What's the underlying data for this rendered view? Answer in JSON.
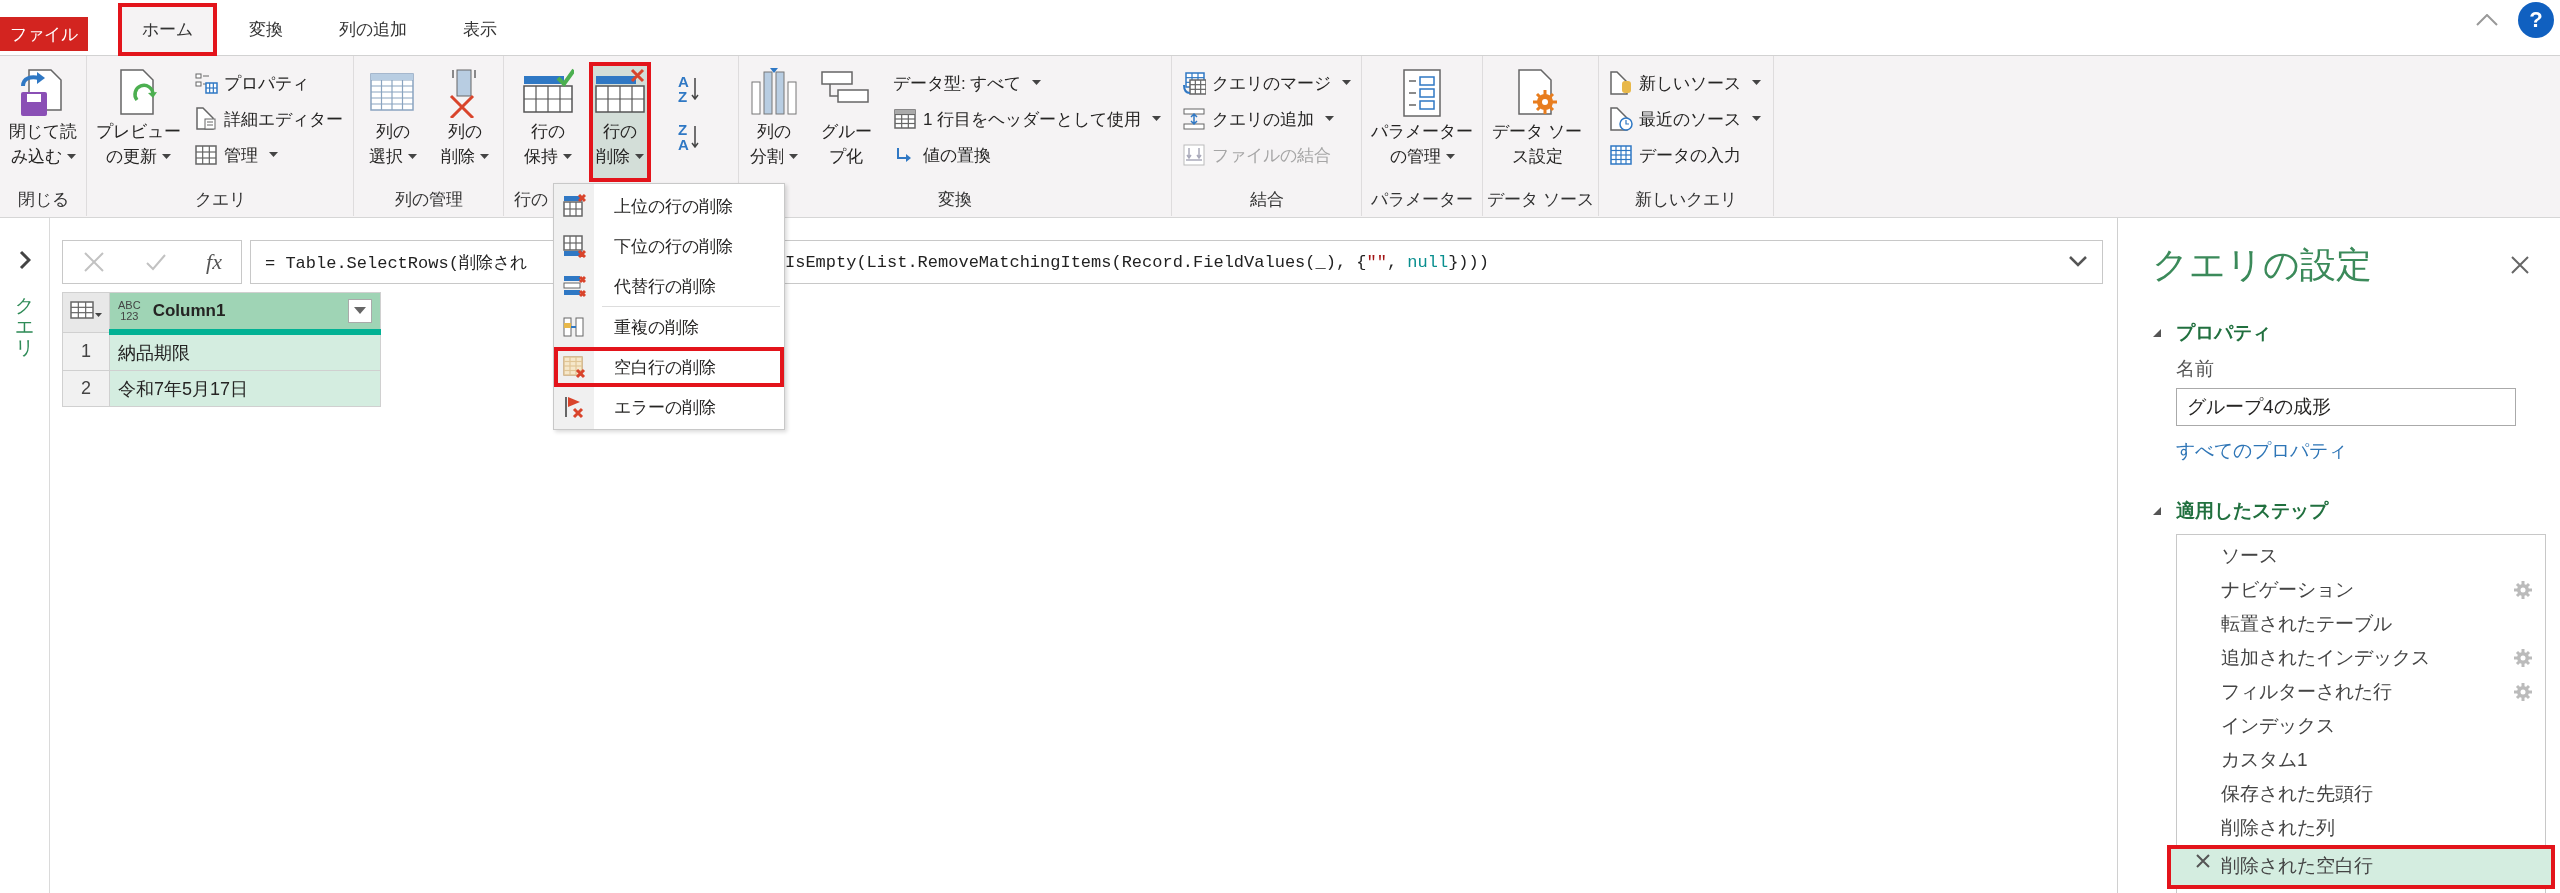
{
  "tabs": [
    {
      "label": "ファイル",
      "kind": "file",
      "selected": false,
      "annotated": false
    },
    {
      "label": "ホーム",
      "kind": "tab",
      "selected": true,
      "annotated": true
    },
    {
      "label": "変換",
      "kind": "tab",
      "selected": false,
      "annotated": false
    },
    {
      "label": "列の追加",
      "kind": "tab",
      "selected": false,
      "annotated": false
    },
    {
      "label": "表示",
      "kind": "tab",
      "selected": false,
      "annotated": false
    }
  ],
  "help_label": "?",
  "ribbon": {
    "groups": [
      {
        "label": "閉じる",
        "buttons": [
          {
            "kind": "large",
            "lines": [
              "閉じて読",
              "み込む"
            ],
            "dropdown": true,
            "disabled": false,
            "pressed": false,
            "annotated": false
          }
        ]
      },
      {
        "label": "クエリ",
        "buttons": [
          {
            "kind": "large",
            "lines": [
              "プレビュー",
              "の更新"
            ],
            "dropdown": true,
            "disabled": false,
            "pressed": false,
            "annotated": false
          },
          {
            "kind": "small",
            "label": "プロパティ",
            "dropdown": false,
            "disabled": false,
            "pressed": false,
            "annotated": false
          },
          {
            "kind": "small",
            "label": "詳細エディター",
            "dropdown": false,
            "disabled": false,
            "pressed": false,
            "annotated": false
          },
          {
            "kind": "small",
            "label": "管理",
            "dropdown": true,
            "disabled": false,
            "pressed": false,
            "annotated": false
          }
        ]
      },
      {
        "label": "列の管理",
        "buttons": [
          {
            "kind": "large",
            "lines": [
              "列の",
              "選択"
            ],
            "dropdown": true,
            "disabled": false,
            "pressed": false,
            "annotated": false
          },
          {
            "kind": "large",
            "lines": [
              "列の",
              "削除"
            ],
            "dropdown": true,
            "disabled": false,
            "pressed": false,
            "annotated": false
          }
        ]
      },
      {
        "label": "行の",
        "buttons": [
          {
            "kind": "large",
            "lines": [
              "行の",
              "保持"
            ],
            "dropdown": true,
            "disabled": false,
            "pressed": false,
            "annotated": false
          },
          {
            "kind": "large",
            "lines": [
              "行の",
              "削除"
            ],
            "dropdown": true,
            "disabled": false,
            "pressed": true,
            "annotated": true
          }
        ]
      },
      {
        "buttons": [
          {
            "kind": "sort",
            "top": "A",
            "bottom": "Z",
            "dropdown": false,
            "disabled": false,
            "pressed": false,
            "annotated": false
          },
          {
            "kind": "sort",
            "top": "Z",
            "bottom": "A",
            "dropdown": false,
            "disabled": false,
            "pressed": false,
            "annotated": false
          }
        ]
      },
      {
        "label": "変換",
        "buttons": [
          {
            "kind": "large",
            "lines": [
              "列の",
              "分割"
            ],
            "dropdown": true,
            "disabled": false,
            "pressed": false,
            "annotated": false
          },
          {
            "kind": "large",
            "lines": [
              "グルー",
              "プ化"
            ],
            "dropdown": false,
            "disabled": false,
            "pressed": false,
            "annotated": false
          },
          {
            "kind": "small",
            "label": "データ型: すべて",
            "dropdown": true,
            "disabled": false,
            "pressed": false,
            "annotated": false
          },
          {
            "kind": "small",
            "label": "1 行目をヘッダーとして使用",
            "dropdown": true,
            "disabled": false,
            "pressed": false,
            "annotated": false
          },
          {
            "kind": "small",
            "label": "値の置換",
            "dropdown": false,
            "disabled": false,
            "pressed": false,
            "annotated": false
          }
        ]
      },
      {
        "label": "結合",
        "buttons": [
          {
            "kind": "small",
            "label": "クエリのマージ",
            "dropdown": true,
            "disabled": false,
            "pressed": false,
            "annotated": false
          },
          {
            "kind": "small",
            "label": "クエリの追加",
            "dropdown": true,
            "disabled": false,
            "pressed": false,
            "annotated": false
          },
          {
            "kind": "small",
            "label": "ファイルの結合",
            "dropdown": false,
            "disabled": true,
            "pressed": false,
            "annotated": false
          }
        ]
      },
      {
        "label": "パラメーター",
        "buttons": [
          {
            "kind": "large",
            "lines": [
              "パラメーター",
              "の管理"
            ],
            "dropdown": true,
            "disabled": false,
            "pressed": false,
            "annotated": false
          }
        ]
      },
      {
        "label": "データ ソース",
        "buttons": [
          {
            "kind": "large",
            "lines": [
              "データ ソー",
              "ス設定"
            ],
            "dropdown": false,
            "disabled": false,
            "pressed": false,
            "annotated": false
          }
        ]
      },
      {
        "label": "新しいクエリ",
        "buttons": [
          {
            "kind": "small",
            "label": "新しいソース",
            "dropdown": true,
            "disabled": false,
            "pressed": false,
            "annotated": false
          },
          {
            "kind": "small",
            "label": "最近のソース",
            "dropdown": true,
            "disabled": false,
            "pressed": false,
            "annotated": false
          },
          {
            "kind": "small",
            "label": "データの入力",
            "dropdown": false,
            "disabled": false,
            "pressed": false,
            "annotated": false
          }
        ]
      }
    ]
  },
  "queries_pane": {
    "label": "クエリ"
  },
  "formula_bar": {
    "fx_label": "fx",
    "left": [
      {
        "text": "= Table.SelectRows(削除され",
        "kind": "code"
      }
    ],
    "right": [
      {
        "text": "IsEmpty(List.RemoveMatchingItems(Record.FieldValues(_), {",
        "kind": "code"
      },
      {
        "text": "\"\"",
        "kind": "string"
      },
      {
        "text": ", ",
        "kind": "code"
      },
      {
        "text": "null",
        "kind": "keyword"
      },
      {
        "text": "})))",
        "kind": "code"
      }
    ]
  },
  "table": {
    "columns": [
      {
        "type": "ABC\n123",
        "name": "Column1"
      }
    ],
    "rows": [
      {
        "index": "1",
        "cells": [
          "納品期限"
        ]
      },
      {
        "index": "2",
        "cells": [
          "令和7年5月17日"
        ]
      }
    ]
  },
  "menu": {
    "items": [
      {
        "kind": "item",
        "label": "上位の行の削除",
        "annotated": false
      },
      {
        "kind": "item",
        "label": "下位の行の削除",
        "annotated": false
      },
      {
        "kind": "item",
        "label": "代替行の削除",
        "annotated": false
      },
      {
        "kind": "separator"
      },
      {
        "kind": "item",
        "label": "重複の削除",
        "annotated": false
      },
      {
        "kind": "item",
        "label": "空白行の削除",
        "annotated": true
      },
      {
        "kind": "item",
        "label": "エラーの削除",
        "annotated": false
      }
    ]
  },
  "settings": {
    "title": "クエリの設定",
    "properties": {
      "heading": "プロパティ",
      "name_label": "名前",
      "name_value": "グループ4の成形",
      "link": "すべてのプロパティ"
    },
    "steps_heading": "適用したステップ",
    "steps": [
      {
        "label": "ソース",
        "has_settings": false,
        "selected": false,
        "annotated": false
      },
      {
        "label": "ナビゲーション",
        "has_settings": true,
        "selected": false,
        "annotated": false
      },
      {
        "label": "転置されたテーブル",
        "has_settings": false,
        "selected": false,
        "annotated": false
      },
      {
        "label": "追加されたインデックス",
        "has_settings": true,
        "selected": false,
        "annotated": false
      },
      {
        "label": "フィルターされた行",
        "has_settings": true,
        "selected": false,
        "annotated": false
      },
      {
        "label": "インデックス",
        "has_settings": false,
        "selected": false,
        "annotated": false
      },
      {
        "label": "カスタム1",
        "has_settings": false,
        "selected": false,
        "annotated": false
      },
      {
        "label": "保存された先頭行",
        "has_settings": false,
        "selected": false,
        "annotated": false
      },
      {
        "label": "削除された列",
        "has_settings": false,
        "selected": false,
        "annotated": false
      },
      {
        "label": "削除された空白行",
        "has_settings": false,
        "selected": true,
        "annotated": true
      }
    ]
  }
}
